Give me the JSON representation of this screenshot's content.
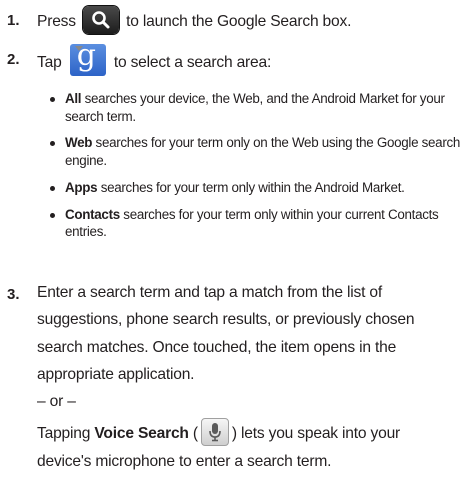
{
  "steps": [
    {
      "number": "1.",
      "before_icon": "Press",
      "icon": "search-key-icon",
      "after_icon": "to launch the Google Search box."
    },
    {
      "number": "2.",
      "before_icon": "Tap",
      "icon": "google-g-icon",
      "after_icon": "to select a search area:",
      "bullets": [
        {
          "term": "All",
          "text": " searches your device, the Web, and the Android Market for your search term."
        },
        {
          "term": "Web",
          "text": " searches for your term only on the Web using the Google search engine."
        },
        {
          "term": "Apps",
          "text": " searches for your term only within the Android Market."
        },
        {
          "term": "Contacts",
          "text": " searches for your term only within your current Contacts entries."
        }
      ]
    },
    {
      "number": "3.",
      "line1": "Enter a search term and tap a match from the list of",
      "line2": "suggestions, phone search results, or previously chosen",
      "line3": "search matches. Once touched, the item opens in the",
      "line4": "appropriate application.",
      "or": "– or –",
      "voice_prefix": "Tapping ",
      "voice_term": "Voice Search",
      "voice_open": " (",
      "voice_icon": "microphone-icon",
      "voice_close": ") lets you speak into your",
      "voice_line2": "device's microphone to enter a search term."
    }
  ],
  "colors": {
    "text": "#231f20",
    "g_icon_bg": "#3a6fd3",
    "search_key_bg": "#2a2a2a"
  }
}
